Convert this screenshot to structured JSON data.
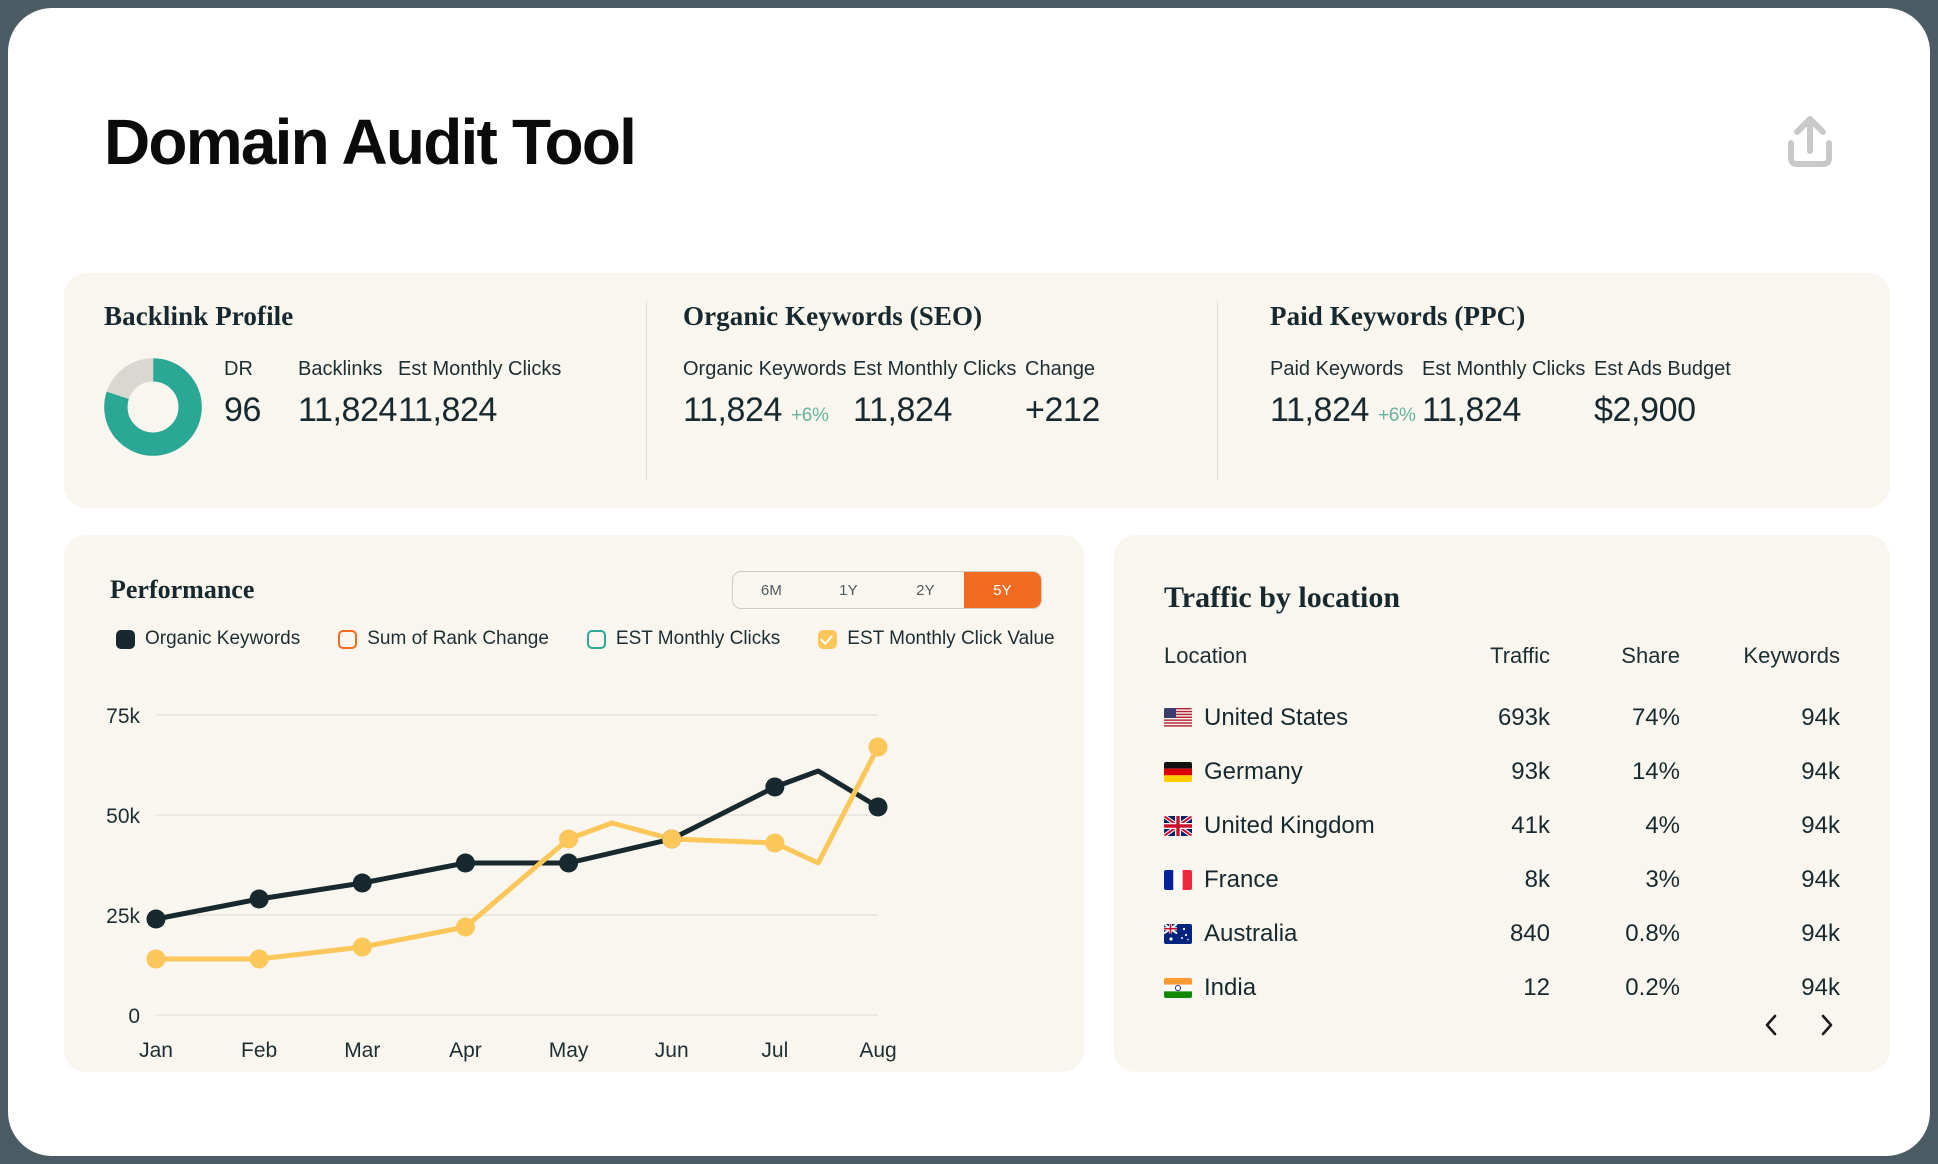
{
  "header": {
    "title": "Domain Audit Tool",
    "share_icon": "upload-share-icon"
  },
  "stats": {
    "backlink": {
      "title": "Backlink Profile",
      "donut": {
        "value": 96,
        "max": 100,
        "filled_pct": 80,
        "color": "#2ba795",
        "track_color": "#d9d7d0"
      },
      "metrics": [
        {
          "label": "DR",
          "value": "96"
        },
        {
          "label": "Backlinks",
          "value": "11,824"
        },
        {
          "label": "Est Monthly Clicks",
          "value": "11,824"
        }
      ]
    },
    "organic": {
      "title": "Organic Keywords (SEO)",
      "metrics": [
        {
          "label": "Organic Keywords",
          "value": "11,824",
          "delta": "+6%"
        },
        {
          "label": "Est Monthly Clicks",
          "value": "11,824"
        },
        {
          "label": "Change",
          "value": "+212"
        }
      ]
    },
    "paid": {
      "title": "Paid Keywords (PPC)",
      "metrics": [
        {
          "label": "Paid Keywords",
          "value": "11,824",
          "delta": "+6%"
        },
        {
          "label": "Est Monthly Clicks",
          "value": "11,824"
        },
        {
          "label": "Est Ads Budget",
          "value": "$2,900"
        }
      ]
    }
  },
  "performance": {
    "title": "Performance",
    "ranges": [
      {
        "label": "6M",
        "active": false
      },
      {
        "label": "1Y",
        "active": false
      },
      {
        "label": "2Y",
        "active": false
      },
      {
        "label": "5Y",
        "active": true
      }
    ],
    "active_range": "5Y",
    "accent_color": "#f26b21",
    "legend": [
      {
        "label": "Organic Keywords",
        "style": "filled",
        "color": "#17292e",
        "checked": true
      },
      {
        "label": "Sum of Rank Change",
        "style": "outline",
        "color": "#f26b21",
        "checked": false
      },
      {
        "label": "EST Monthly Clicks",
        "style": "outline",
        "color": "#2ba795",
        "checked": false
      },
      {
        "label": "EST Monthly Click Value",
        "style": "checked",
        "color": "#fbc75a",
        "checked": true
      }
    ]
  },
  "chart_data": {
    "type": "line",
    "title": "Performance",
    "xlabel": "",
    "ylabel": "",
    "categories": [
      "Jan",
      "Feb",
      "Mar",
      "Apr",
      "May",
      "Jun",
      "Jul",
      "Aug"
    ],
    "ytick_labels": [
      "0",
      "25k",
      "50k",
      "75k"
    ],
    "ytick_values": [
      0,
      25000,
      50000,
      75000
    ],
    "ylim": [
      0,
      75000
    ],
    "grid": true,
    "legend_position": "top-left",
    "series": [
      {
        "name": "Organic Keywords",
        "color": "#17292e",
        "markers": true,
        "values": [
          24000,
          29000,
          33000,
          38000,
          38000,
          44000,
          57000,
          52000
        ],
        "interpolation_peaks": [
          {
            "after": "Jul",
            "value": 61000
          }
        ]
      },
      {
        "name": "EST Monthly Click Value",
        "color": "#fbc75a",
        "markers": true,
        "values": [
          14000,
          14000,
          17000,
          22000,
          44000,
          44000,
          43000,
          67000
        ],
        "interpolation_peaks": [
          {
            "after": "May",
            "value": 48000
          },
          {
            "after": "Jul",
            "value": 38000
          }
        ]
      }
    ],
    "hidden_series": [
      "Sum of Rank Change",
      "EST Monthly Clicks"
    ]
  },
  "traffic": {
    "title": "Traffic by location",
    "columns": [
      "Location",
      "Traffic",
      "Share",
      "Keywords"
    ],
    "rows": [
      {
        "flag": "us-flag",
        "location": "United States",
        "traffic": "693k",
        "share": "74%",
        "keywords": "94k"
      },
      {
        "flag": "de-flag",
        "location": "Germany",
        "traffic": "93k",
        "share": "14%",
        "keywords": "94k"
      },
      {
        "flag": "gb-flag",
        "location": "United Kingdom",
        "traffic": "41k",
        "share": "4%",
        "keywords": "94k"
      },
      {
        "flag": "fr-flag",
        "location": "France",
        "traffic": "8k",
        "share": "3%",
        "keywords": "94k"
      },
      {
        "flag": "au-flag",
        "location": "Australia",
        "traffic": "840",
        "share": "0.8%",
        "keywords": "94k"
      },
      {
        "flag": "in-flag",
        "location": "India",
        "traffic": "12",
        "share": "0.2%",
        "keywords": "94k"
      }
    ],
    "pager": {
      "prev_icon": "chevron-left-icon",
      "next_icon": "chevron-right-icon"
    }
  }
}
